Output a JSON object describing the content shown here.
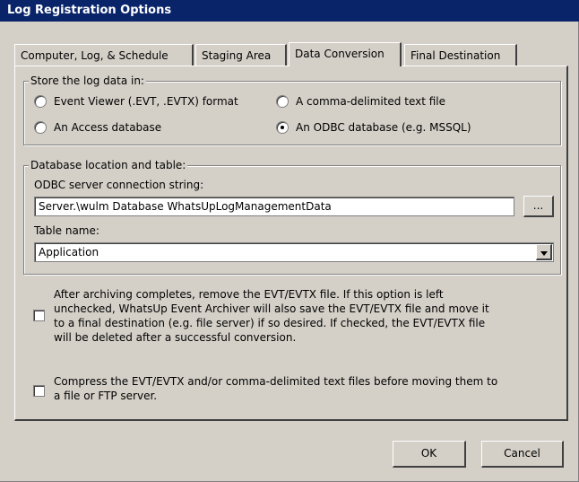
{
  "window": {
    "title": "Log Registration Options"
  },
  "tabs": [
    {
      "label": "Computer, Log, & Schedule"
    },
    {
      "label": "Staging Area"
    },
    {
      "label": "Data Conversion"
    },
    {
      "label": "Final Destination"
    }
  ],
  "store": {
    "legend": "Store the log data in:",
    "options": [
      {
        "label": "Event Viewer (.EVT, .EVTX) format",
        "selected": false
      },
      {
        "label": "A comma-delimited text file",
        "selected": false
      },
      {
        "label": "An Access database",
        "selected": false
      },
      {
        "label": "An ODBC database (e.g. MSSQL)",
        "selected": true
      }
    ]
  },
  "database": {
    "legend": "Database location and table:",
    "conn_label": "ODBC server connection string:",
    "conn_value": "Server.\\wulm Database WhatsUpLogManagementData",
    "browse_label": "...",
    "table_label": "Table name:",
    "table_value": "Application"
  },
  "options": {
    "remove_evt": {
      "checked": false,
      "text": "After archiving completes, remove the EVT/EVTX file.  If this option is left\nunchecked, WhatsUp Event Archiver will also save the EVT/EVTX file and move it\nto a final destination (e.g. file server) if so desired.  If checked, the EVT/EVTX file\nwill be deleted after a successful conversion."
    },
    "compress": {
      "checked": false,
      "text": "Compress the EVT/EVTX and/or comma-delimited text files before moving them to\na file or FTP server."
    }
  },
  "footer": {
    "ok_label": "OK",
    "cancel_label": "Cancel"
  }
}
